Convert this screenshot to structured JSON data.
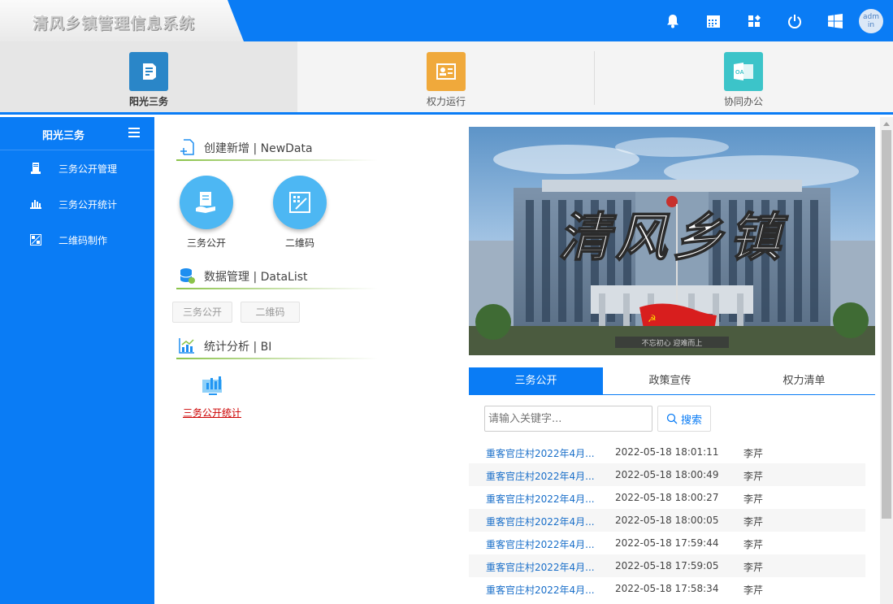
{
  "app": {
    "title": "清风乡镇管理信息系统"
  },
  "header": {
    "icons": [
      "bell-icon",
      "calendar-icon",
      "apps-icon",
      "power-icon",
      "windows-icon"
    ],
    "user": "adm in"
  },
  "modules": [
    {
      "label": "阳光三务",
      "icon": "document-icon",
      "color": "#2a86c8",
      "active": true
    },
    {
      "label": "权力运行",
      "icon": "certificate-icon",
      "color": "#f0a93b",
      "active": false
    },
    {
      "label": "协同办公",
      "icon": "outlook-icon",
      "color": "#3cc4c9",
      "active": false
    }
  ],
  "sidebar": {
    "title": "阳光三务",
    "items": [
      {
        "label": "三务公开管理",
        "icon": "server-icon"
      },
      {
        "label": "三务公开统计",
        "icon": "chart-icon"
      },
      {
        "label": "二维码制作",
        "icon": "qrcode-icon"
      }
    ]
  },
  "sections": {
    "create": {
      "title": "创建新增 | NewData",
      "buttons": [
        {
          "label": "三务公开",
          "icon": "report-icon"
        },
        {
          "label": "二维码",
          "icon": "qrcode-icon"
        }
      ]
    },
    "data": {
      "title": "数据管理 | DataList",
      "buttons": [
        "三务公开",
        "二维码"
      ]
    },
    "stats": {
      "title": "统计分析 | BI",
      "link": "三务公开统计"
    }
  },
  "banner": {
    "text": "清风乡镇",
    "caption": "不忘初心 迎难而上"
  },
  "tabs": [
    "三务公开",
    "政策宣传",
    "权力清单"
  ],
  "search": {
    "placeholder": "请输入关键字...",
    "button": "搜索"
  },
  "list": [
    {
      "title": "重客官庄村2022年4月...",
      "time": "2022-05-18 18:01:11",
      "author": "李芹"
    },
    {
      "title": "重客官庄村2022年4月...",
      "time": "2022-05-18 18:00:49",
      "author": "李芹"
    },
    {
      "title": "重客官庄村2022年4月...",
      "time": "2022-05-18 18:00:27",
      "author": "李芹"
    },
    {
      "title": "重客官庄村2022年4月...",
      "time": "2022-05-18 18:00:05",
      "author": "李芹"
    },
    {
      "title": "重客官庄村2022年4月...",
      "time": "2022-05-18 17:59:44",
      "author": "李芹"
    },
    {
      "title": "重客官庄村2022年4月...",
      "time": "2022-05-18 17:59:05",
      "author": "李芹"
    },
    {
      "title": "重客官庄村2022年4月...",
      "time": "2022-05-18 17:58:34",
      "author": "李芹"
    }
  ]
}
